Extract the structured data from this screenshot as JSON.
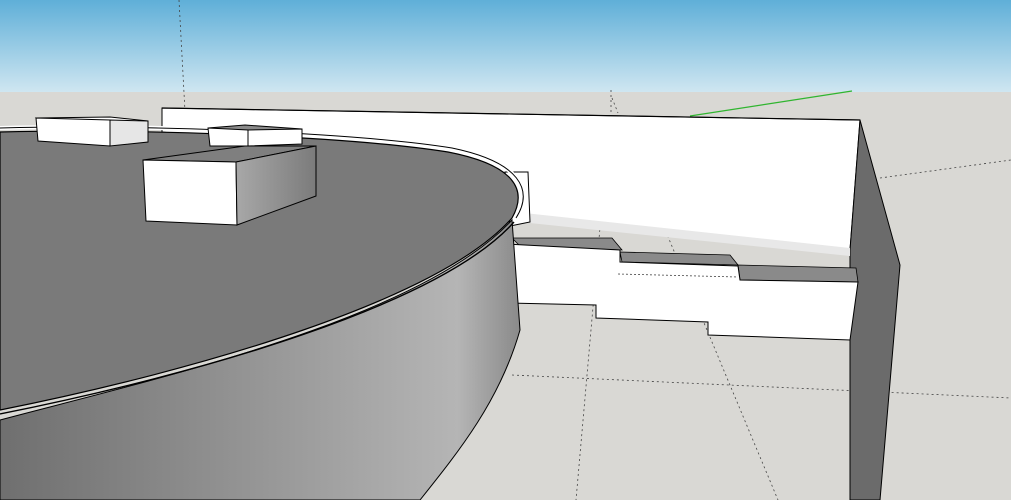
{
  "viewport": {
    "sky_top_color": "#5fafd8",
    "sky_bottom_color": "#cfe6f1",
    "ground_color": "#d9d8d4",
    "face_light_color": "#ffffff",
    "face_gray_color": "#8f8f8f",
    "face_dark_color": "#6b6b6b",
    "edge_color": "#000000",
    "green_axis_color": "#2fb52f",
    "guide_line_color": "#444444"
  },
  "scene": {
    "objects": [
      {
        "name": "ground-plane"
      },
      {
        "name": "circular-platform"
      },
      {
        "name": "back-wall"
      },
      {
        "name": "stepped-block"
      },
      {
        "name": "small-box-left"
      },
      {
        "name": "small-box-center"
      },
      {
        "name": "large-box"
      },
      {
        "name": "small-post"
      },
      {
        "name": "green-axis"
      },
      {
        "name": "guide-lines"
      }
    ]
  }
}
